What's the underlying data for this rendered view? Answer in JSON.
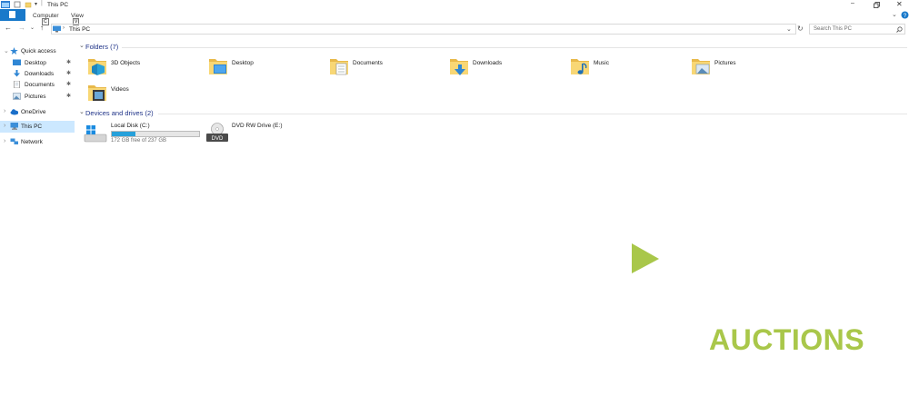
{
  "window": {
    "title": "This PC"
  },
  "ribbon": {
    "tabs": [
      {
        "label": "Computer",
        "keytip": "C"
      },
      {
        "label": "View",
        "keytip": "V"
      }
    ]
  },
  "address": {
    "path_label": "This PC",
    "search_placeholder": "Search This PC"
  },
  "navigation": {
    "items": [
      {
        "label": "Quick access",
        "icon": "star-icon"
      },
      {
        "label": "Desktop",
        "icon": "desktop-icon",
        "pinned": true
      },
      {
        "label": "Downloads",
        "icon": "download-icon",
        "pinned": true
      },
      {
        "label": "Documents",
        "icon": "documents-icon",
        "pinned": true
      },
      {
        "label": "Pictures",
        "icon": "pictures-icon",
        "pinned": true
      },
      {
        "label": "OneDrive",
        "icon": "cloud-icon"
      },
      {
        "label": "This PC",
        "icon": "computer-icon",
        "selected": true
      },
      {
        "label": "Network",
        "icon": "network-icon"
      }
    ]
  },
  "folders_group": {
    "title": "Folders (7)"
  },
  "folders": [
    {
      "label": "3D Objects",
      "icon": "3d-objects-folder-icon"
    },
    {
      "label": "Desktop",
      "icon": "desktop-folder-icon"
    },
    {
      "label": "Documents",
      "icon": "documents-folder-icon"
    },
    {
      "label": "Downloads",
      "icon": "downloads-folder-icon"
    },
    {
      "label": "Music",
      "icon": "music-folder-icon"
    },
    {
      "label": "Pictures",
      "icon": "pictures-folder-icon"
    },
    {
      "label": "Videos",
      "icon": "videos-folder-icon"
    }
  ],
  "devices_group": {
    "title": "Devices and drives (2)"
  },
  "drives": [
    {
      "label": "Local Disk (C:)",
      "free_text": "172 GB free of 237 GB",
      "used_fraction": 0.27,
      "icon": "local-disk-icon"
    },
    {
      "label": "DVD RW Drive (E:)",
      "icon": "dvd-drive-icon"
    }
  ],
  "watermark": {
    "text": "AUCTIONS",
    "color": "#a9c74a"
  },
  "colors": {
    "accent": "#1979ca",
    "selected_bg": "#cce8ff",
    "drive_fill": "#26a0da",
    "group_title": "#1e3287"
  }
}
